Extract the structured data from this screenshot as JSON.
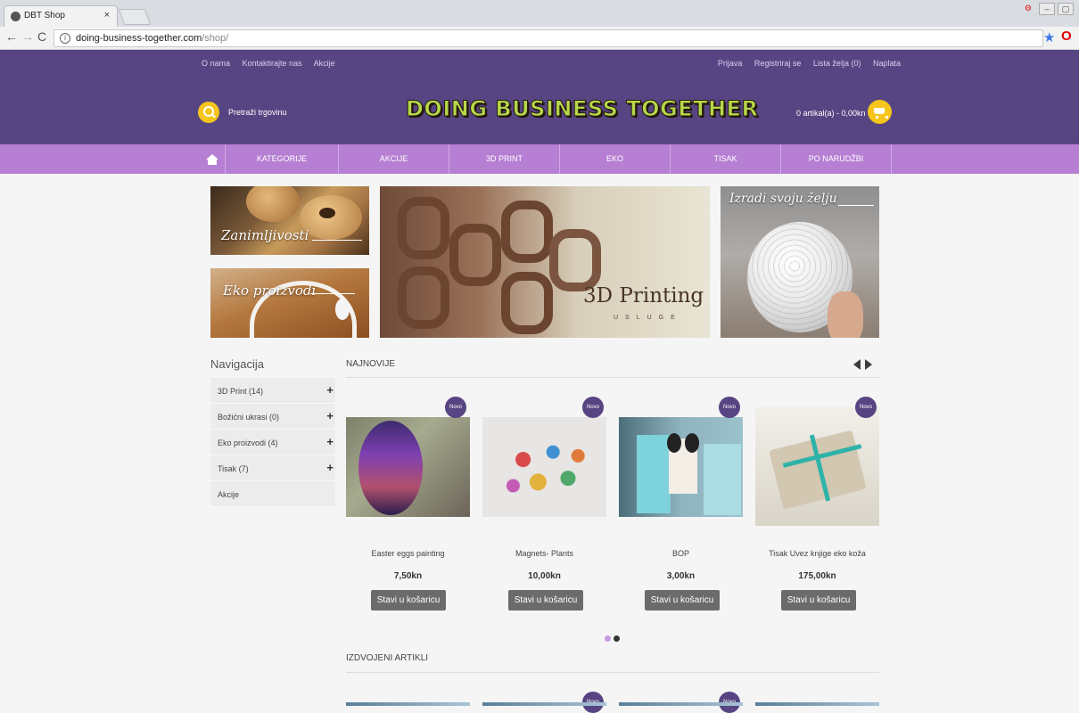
{
  "browser": {
    "tab_title": "DBT Shop",
    "tab_close": "×",
    "url_domain": "doing-business-together.com",
    "url_path": "/shop/",
    "info_glyph": "i"
  },
  "header": {
    "left_links": [
      "O nama",
      "Kontaktirajte nas",
      "Akcije"
    ],
    "right_links": [
      "Prijava",
      "Registriraj se",
      "Lista želja (0)",
      "Naplata"
    ],
    "search_label": "Pretraži trgovinu",
    "logo": "DOING BUSINESS TOGETHER",
    "cart_text": "0 artikal(a) - 0,00kn"
  },
  "nav": {
    "items": [
      "KATEGORIJE",
      "AKCIJE",
      "3D PRINT",
      "EKO",
      "TISAK",
      "PO NARUDŽBI"
    ]
  },
  "banners": {
    "b1": "Zanimljivosti",
    "b2": "Eko proizvodi",
    "b3_big": "3D Printing",
    "b3_small": "USLUGE",
    "b4": "Izradi svoju želju"
  },
  "sidebar": {
    "title": "Navigacija",
    "items": [
      {
        "label": "3D Print (14)",
        "plus": "+"
      },
      {
        "label": "Božićni ukrasi (0)",
        "plus": "+"
      },
      {
        "label": "Eko proizvodi (4)",
        "plus": "+"
      },
      {
        "label": "Tisak (7)",
        "plus": "+"
      },
      {
        "label": "Akcije",
        "plus": ""
      }
    ]
  },
  "sections": {
    "newest": "NAJNOVIJE",
    "featured": "IZDVOJENI ARTIKLI"
  },
  "badge": "Novo",
  "products": [
    {
      "name": "Easter eggs painting",
      "price": "7,50kn",
      "button": "Stavi u košaricu"
    },
    {
      "name": "Magnets- Plants",
      "price": "10,00kn",
      "button": "Stavi u košaricu"
    },
    {
      "name": "BOP",
      "price": "3,00kn",
      "button": "Stavi u košaricu"
    },
    {
      "name": "Tisak Uvez knjige eko koža",
      "price": "175,00kn",
      "button": "Stavi u košaricu"
    }
  ],
  "colors": {
    "header_bg": "#574583",
    "nav_bg": "#b67fd3",
    "accent_yellow": "#f5c51c",
    "dot_active": "#c89ae0",
    "dot_inactive": "#333333"
  }
}
